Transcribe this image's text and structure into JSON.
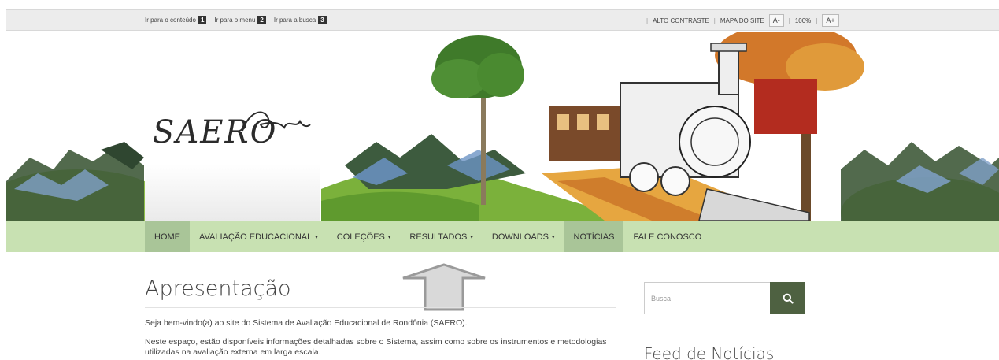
{
  "accessibility_bar": {
    "links": [
      {
        "label": "Ir para o conteúdo",
        "key": "1"
      },
      {
        "label": "Ir para o menu",
        "key": "2"
      },
      {
        "label": "Ir para a busca",
        "key": "3"
      }
    ],
    "high_contrast": "ALTO CONTRASTE",
    "site_map": "MAPA DO SITE",
    "font_decrease": "A-",
    "zoom": "100%",
    "font_increase": "A+"
  },
  "logo": {
    "text": "SAERO"
  },
  "nav": {
    "items": [
      {
        "label": "HOME",
        "dropdown": false
      },
      {
        "label": "AVALIAÇÃO EDUCACIONAL",
        "dropdown": true
      },
      {
        "label": "COLEÇÕES",
        "dropdown": true
      },
      {
        "label": "RESULTADOS",
        "dropdown": true
      },
      {
        "label": "DOWNLOADS",
        "dropdown": true
      },
      {
        "label": "NOTÍCIAS",
        "dropdown": false
      },
      {
        "label": "FALE CONOSCO",
        "dropdown": false
      }
    ],
    "caret": "▾"
  },
  "content": {
    "title": "Apresentação",
    "paragraph1": "Seja bem-vindo(a) ao site do Sistema de Avaliação Educacional de Rondônia (SAERO).",
    "paragraph2": "Neste espaço, estão disponíveis informações detalhadas sobre o Sistema, assim como sobre os instrumentos e metodologias utilizadas na avaliação externa em larga escala."
  },
  "sidebar": {
    "search_placeholder": "Busca",
    "search_icon": "search-icon",
    "feed_title": "Feed de Notícias"
  },
  "colors": {
    "nav_bg": "#c8e1b2",
    "nav_active": "#a9c598",
    "search_button": "#4e6141"
  }
}
